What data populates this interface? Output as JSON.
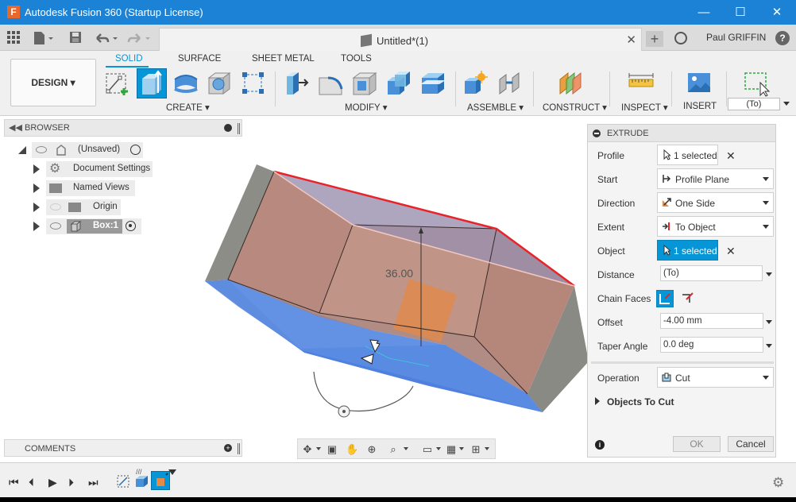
{
  "window": {
    "app_logo": "F",
    "title": "Autodesk Fusion 360 (Startup License)",
    "minimize": "—",
    "maximize": "☐",
    "close": "✕"
  },
  "quickbar": {
    "document_title": "Untitled*(1)",
    "close_tab": "✕",
    "new_tab": "+",
    "username": "Paul GRIFFIN",
    "help": "?"
  },
  "ribbon": {
    "workspace": "DESIGN ▾",
    "tabs": [
      "SOLID",
      "SURFACE",
      "SHEET METAL",
      "TOOLS"
    ],
    "active_tab": "SOLID",
    "groups": [
      "CREATE ▾",
      "MODIFY ▾",
      "ASSEMBLE ▾",
      "CONSTRUCT ▾",
      "INSPECT ▾",
      "INSERT",
      ""
    ],
    "to_field": "(To)"
  },
  "browser": {
    "header": "BROWSER",
    "nodes": [
      {
        "label": "(Unsaved)"
      },
      {
        "label": "Document Settings"
      },
      {
        "label": "Named Views"
      },
      {
        "label": "Origin"
      },
      {
        "label": "Box:1"
      }
    ]
  },
  "comments": {
    "label": "COMMENTS",
    "add": "+"
  },
  "viewport": {
    "dimension_label": "36.00"
  },
  "extrude": {
    "title": "EXTRUDE",
    "rows": {
      "profile": {
        "label": "Profile",
        "value": "1 selected"
      },
      "start": {
        "label": "Start",
        "value": "Profile Plane"
      },
      "direction": {
        "label": "Direction",
        "value": "One Side"
      },
      "extent": {
        "label": "Extent",
        "value": "To Object"
      },
      "object": {
        "label": "Object",
        "value": "1 selected"
      },
      "distance": {
        "label": "Distance",
        "value": "(To)"
      },
      "chain_faces": {
        "label": "Chain Faces"
      },
      "offset": {
        "label": "Offset",
        "value": "-4.00 mm"
      },
      "taper_angle": {
        "label": "Taper Angle",
        "value": "0.0 deg"
      },
      "operation": {
        "label": "Operation",
        "value": "Cut"
      }
    },
    "objects_to_cut": "Objects To Cut",
    "info": "i",
    "ok": "OK",
    "cancel": "Cancel",
    "clear": "✕"
  },
  "timeline": {
    "first": "⏮",
    "prev": "⏴",
    "play": "▶",
    "next": "⏵",
    "last": "⏭",
    "settings": "⚙"
  },
  "colors": {
    "titlebar": "#1c82d6",
    "accent": "#0696d7",
    "selection_red": "#e8232a",
    "cut_face": "#b98a7e",
    "blue_face": "#4d7fe0",
    "gray_face": "#8a8a84"
  }
}
